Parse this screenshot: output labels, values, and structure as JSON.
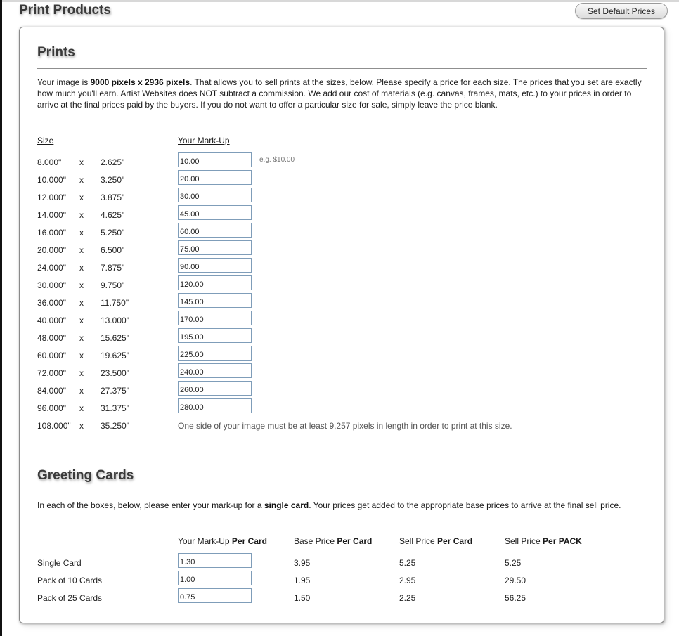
{
  "header": {
    "title": "Print Products",
    "default_prices_button": "Set Default Prices"
  },
  "prints": {
    "title": "Prints",
    "intro": {
      "prefix": "Your image is ",
      "dimensions": "9000 pixels x 2936 pixels",
      "suffix": ".   That allows you to sell prints at the sizes, below.   Please specify a price for each size.   The prices that you set are exactly how much you'll earn.   Artist Websites does NOT subtract a commission.   We add our cost of materials (e.g. canvas, frames, mats, etc.) to your prices in order to arrive at the final prices paid by the buyers.   If you do not want to offer a particular size for sale, simply leave the price blank."
    },
    "columns": {
      "size": "Size",
      "markup": "Your Mark-Up"
    },
    "times_symbol": "x",
    "example_hint": "e.g. $10.00",
    "sizes": [
      {
        "width": "8.000\"",
        "height": "2.625\"",
        "markup": "10.00"
      },
      {
        "width": "10.000\"",
        "height": "3.250\"",
        "markup": "20.00"
      },
      {
        "width": "12.000\"",
        "height": "3.875\"",
        "markup": "30.00"
      },
      {
        "width": "14.000\"",
        "height": "4.625\"",
        "markup": "45.00"
      },
      {
        "width": "16.000\"",
        "height": "5.250\"",
        "markup": "60.00"
      },
      {
        "width": "20.000\"",
        "height": "6.500\"",
        "markup": "75.00"
      },
      {
        "width": "24.000\"",
        "height": "7.875\"",
        "markup": "90.00"
      },
      {
        "width": "30.000\"",
        "height": "9.750\"",
        "markup": "120.00"
      },
      {
        "width": "36.000\"",
        "height": "11.750\"",
        "markup": "145.00"
      },
      {
        "width": "40.000\"",
        "height": "13.000\"",
        "markup": "170.00"
      },
      {
        "width": "48.000\"",
        "height": "15.625\"",
        "markup": "195.00"
      },
      {
        "width": "60.000\"",
        "height": "19.625\"",
        "markup": "225.00"
      },
      {
        "width": "72.000\"",
        "height": "23.500\"",
        "markup": "240.00"
      },
      {
        "width": "84.000\"",
        "height": "27.375\"",
        "markup": "260.00"
      },
      {
        "width": "96.000\"",
        "height": "31.375\"",
        "markup": "280.00"
      },
      {
        "width": "108.000\"",
        "height": "35.250\"",
        "note": "One side of your image must be at least 9,257 pixels in length in order to print at this size."
      }
    ]
  },
  "greeting_cards": {
    "title": "Greeting Cards",
    "intro": {
      "prefix": "In each of the boxes, below, please enter your mark-up for a ",
      "emphasis": "single card",
      "suffix": ".   Your prices get added to the appropriate base prices to arrive at the final sell price."
    },
    "columns": [
      {
        "prefix": "Your Mark-Up ",
        "bold": "Per Card"
      },
      {
        "prefix": "Base Price ",
        "bold": "Per Card"
      },
      {
        "prefix": "Sell Price ",
        "bold": "Per Card"
      },
      {
        "prefix": "Sell Price ",
        "bold": "Per PACK"
      }
    ],
    "rows": [
      {
        "label": "Single Card",
        "markup": "1.30",
        "base_price": "3.95",
        "sell_per_card": "5.25",
        "sell_per_pack": "5.25"
      },
      {
        "label": "Pack of 10 Cards",
        "markup": "1.00",
        "base_price": "1.95",
        "sell_per_card": "2.95",
        "sell_per_pack": "29.50"
      },
      {
        "label": "Pack of 25 Cards",
        "markup": "0.75",
        "base_price": "1.50",
        "sell_per_card": "2.25",
        "sell_per_pack": "56.25"
      }
    ]
  }
}
